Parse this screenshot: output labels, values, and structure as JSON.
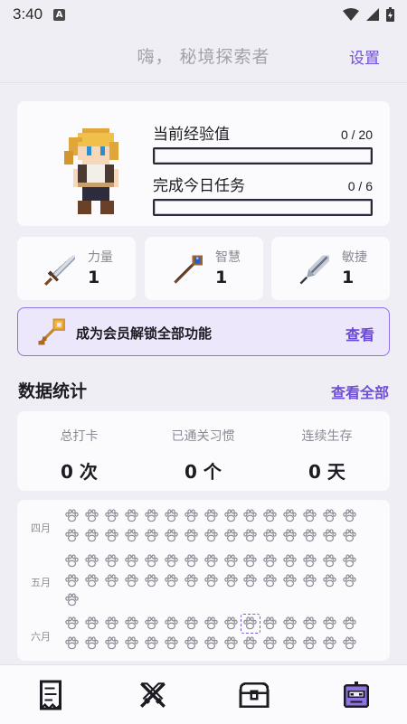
{
  "status_bar": {
    "time": "3:40",
    "badge": "A"
  },
  "header": {
    "title": "嗨， 秘境探索者",
    "settings_label": "设置"
  },
  "profile": {
    "xp_label": "当前经验值",
    "xp_value": "0 / 20",
    "xp_progress": 0,
    "task_label": "完成今日任务",
    "task_value": "0 / 6",
    "task_progress": 0
  },
  "attributes": [
    {
      "name": "力量",
      "value": "1",
      "icon": "sword-icon"
    },
    {
      "name": "智慧",
      "value": "1",
      "icon": "staff-icon"
    },
    {
      "name": "敏捷",
      "value": "1",
      "icon": "feather-icon"
    }
  ],
  "membership": {
    "text": "成为会员解锁全部功能",
    "link": "查看",
    "icon": "key-icon"
  },
  "stats_section": {
    "title": "数据统计",
    "link": "查看全部"
  },
  "stats": [
    {
      "label": "总打卡",
      "value": "0 次"
    },
    {
      "label": "已通关习惯",
      "value": "0 个"
    },
    {
      "label": "连续生存",
      "value": "0 天"
    }
  ],
  "calendar": {
    "months": [
      {
        "label": "四月",
        "days": 30
      },
      {
        "label": "五月",
        "days": 31
      },
      {
        "label": "六月",
        "days": 30
      }
    ],
    "today_index": 9
  },
  "tabs": [
    {
      "name": "tab-checklist",
      "icon": "scroll-icon"
    },
    {
      "name": "tab-battle",
      "icon": "crossed-swords-icon"
    },
    {
      "name": "tab-chest",
      "icon": "treasure-chest-icon"
    },
    {
      "name": "tab-profile",
      "icon": "robot-icon",
      "active": true
    }
  ],
  "colors": {
    "accent": "#6f4fd6",
    "background": "#efeef4",
    "card": "#fbfbfd"
  }
}
